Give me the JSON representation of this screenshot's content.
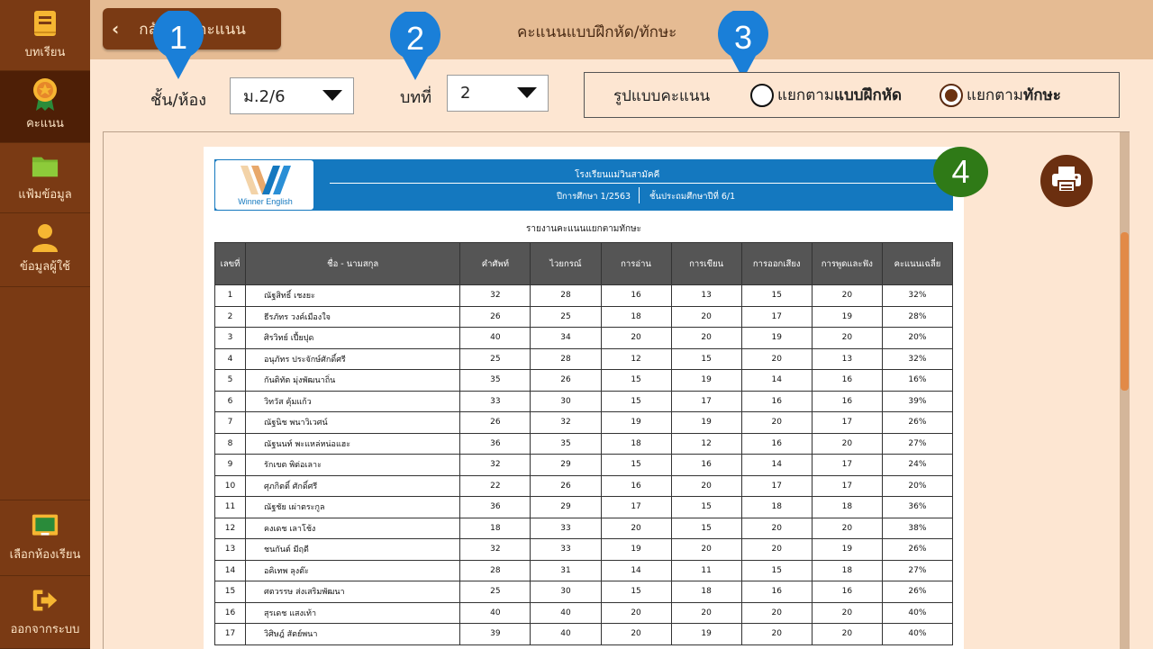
{
  "sidebar": {
    "items": [
      {
        "label": "บทเรียน",
        "icon": "book-icon"
      },
      {
        "label": "คะแนน",
        "icon": "medal-icon",
        "active": true
      },
      {
        "label": "แฟ้มข้อมูล",
        "icon": "folder-icon"
      },
      {
        "label": "ข้อมูลผู้ใช้",
        "icon": "user-icon"
      },
      {
        "label": "เลือกห้องเรียน",
        "icon": "classroom-board-icon"
      },
      {
        "label": "ออกจากระบบ",
        "icon": "logout-icon"
      }
    ]
  },
  "header": {
    "back_label": "กลับหน้าคะแนน",
    "title": "คะแนนแบบฝึกหัด/ทักษะ"
  },
  "markers": [
    "1",
    "2",
    "3",
    "4"
  ],
  "controls": {
    "class_label": "ชั้น/ห้อง",
    "class_value": "ม.2/6",
    "lesson_label": "บทที่",
    "lesson_value": "2",
    "format_label": "รูปแบบคะแนน",
    "option1_prefix": "แยกตาม",
    "option1_bold": "แบบฝึกหัด",
    "option2_prefix": "แยกตาม",
    "option2_bold": "ทักษะ",
    "selected_option": 2
  },
  "report": {
    "logo_text": "Winner English",
    "school": "โรงเรียนแม่วินสามัคคี",
    "year": "ปีการศึกษา 1/2563",
    "grade": "ชั้นประถมศึกษาปีที่ 6/1",
    "title": "รายงานคะแนนแยกตามทักษะ",
    "columns": [
      "เลขที่",
      "ชื่อ - นามสกุล",
      "คำศัพท์",
      "ไวยกรณ์",
      "การอ่าน",
      "การเขียน",
      "การออกเสียง",
      "การพูดและฟัง",
      "คะแนนเฉลี่ย"
    ],
    "rows": [
      [
        "1",
        "ณัฐสิทธิ์ เชงยะ",
        "32",
        "28",
        "16",
        "13",
        "15",
        "20",
        "32%"
      ],
      [
        "2",
        "ธีรภัทร วงค์เมืองใจ",
        "26",
        "25",
        "18",
        "20",
        "17",
        "19",
        "28%"
      ],
      [
        "3",
        "ศิรวิทย์ เปี้ยปุด",
        "40",
        "34",
        "20",
        "20",
        "19",
        "20",
        "20%"
      ],
      [
        "4",
        "อนุภัทร ประจักษ์ศักดิ์ศรี",
        "25",
        "28",
        "12",
        "15",
        "20",
        "13",
        "32%"
      ],
      [
        "5",
        "กันติทัต มุ่งพัฒนาถิ่น",
        "35",
        "26",
        "15",
        "19",
        "14",
        "16",
        "16%"
      ],
      [
        "6",
        "วิทวัส คุ้มแก้ว",
        "33",
        "30",
        "15",
        "17",
        "16",
        "16",
        "39%"
      ],
      [
        "7",
        "ณัฐนิช พนาวิเวศน์",
        "26",
        "32",
        "19",
        "19",
        "20",
        "17",
        "26%"
      ],
      [
        "8",
        "ณัฐนนท์ พะแหล่หน่อแฮะ",
        "36",
        "35",
        "18",
        "12",
        "16",
        "20",
        "27%"
      ],
      [
        "9",
        "รักเขต พิต่อเลาะ",
        "32",
        "29",
        "15",
        "16",
        "14",
        "17",
        "24%"
      ],
      [
        "10",
        "ศุภกิตติ์ ศักดิ์ศรี",
        "22",
        "26",
        "16",
        "20",
        "17",
        "17",
        "20%"
      ],
      [
        "11",
        "ณัฐชัย เผ่าตระกูล",
        "36",
        "29",
        "17",
        "15",
        "18",
        "18",
        "36%"
      ],
      [
        "12",
        "คงเดช เลาโช้ง",
        "18",
        "33",
        "20",
        "15",
        "20",
        "20",
        "38%"
      ],
      [
        "13",
        "ชนกันต์ มีฤดี",
        "32",
        "33",
        "19",
        "20",
        "20",
        "19",
        "26%"
      ],
      [
        "14",
        "อคิเทพ ลุงต๊ะ",
        "28",
        "31",
        "14",
        "11",
        "15",
        "18",
        "27%"
      ],
      [
        "15",
        "ศตวรรษ ส่งเสริมพัฒนา",
        "25",
        "30",
        "15",
        "18",
        "16",
        "16",
        "26%"
      ],
      [
        "16",
        "สุรเดช แสงเท้า",
        "40",
        "40",
        "20",
        "20",
        "20",
        "20",
        "40%"
      ],
      [
        "17",
        "วิศิษฎ์ สัตย์พนา",
        "39",
        "40",
        "20",
        "19",
        "20",
        "20",
        "40%"
      ]
    ]
  },
  "colors": {
    "sidebar": "#7a3a14",
    "sidebar_active": "#4e1f06",
    "marker_blue": "#1a7fd8",
    "marker_green": "#2f7a17",
    "report_header": "#1478bf",
    "table_header": "#555555",
    "scroll_thumb": "#e28a47"
  }
}
